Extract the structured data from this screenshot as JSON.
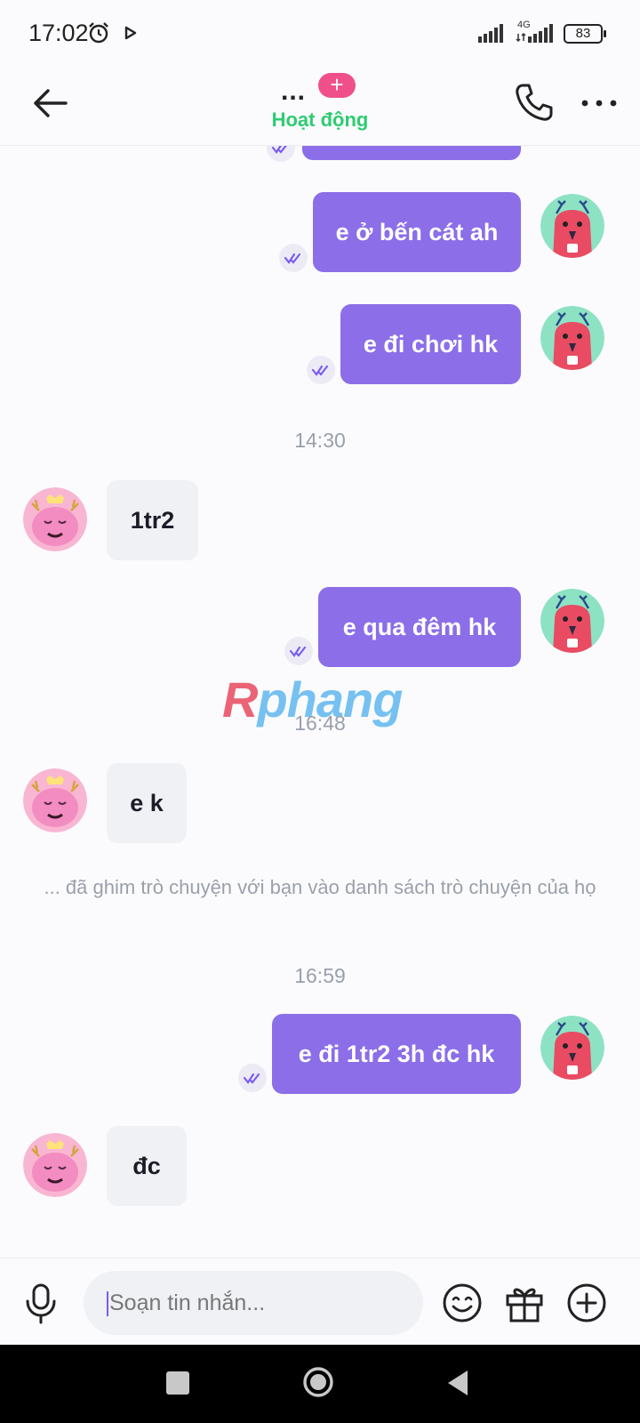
{
  "status_bar": {
    "time": "17:02",
    "network": "4G",
    "battery": "83"
  },
  "header": {
    "title_placeholder": "...",
    "plus_badge": "+",
    "status": "Hoạt động",
    "icons": [
      "back-arrow-icon",
      "phone-icon",
      "more-dots-icon"
    ]
  },
  "messages": {
    "m1": "e ở bến cát ah",
    "m2": "e đi chơi hk",
    "t1": "14:30",
    "m3": "1tr2",
    "m4": "e qua đêm hk",
    "t2": "16:48",
    "m5": "e k",
    "system": "... đã ghim trò chuyện với bạn vào danh sách trò chuyện của họ",
    "t3": "16:59",
    "m6": "e đi 1tr2 3h đc hk",
    "m7": "đc"
  },
  "watermark": {
    "first": "R",
    "rest": "phang"
  },
  "composer": {
    "placeholder": "Soạn tin nhắn..."
  },
  "colors": {
    "outgoing_bubble": "#8b6ee8",
    "incoming_bubble": "#f0f1f5",
    "status_green": "#2ecc71",
    "badge_pink": "#f0508a"
  }
}
